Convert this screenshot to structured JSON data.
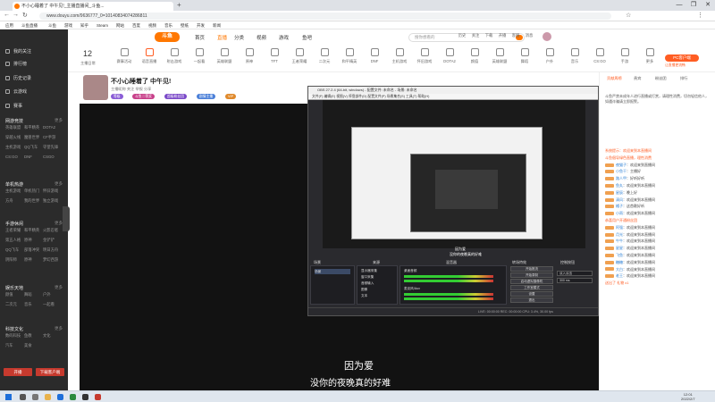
{
  "browser": {
    "tab_title": "不小心睡着了 中午见!_主播直播间_斗鱼...",
    "url": "www.douyu.com/9636777_0=10140834074286811",
    "bookmarks": [
      "应用",
      "斗鱼直播",
      "斗鱼",
      "游戏",
      "知乎",
      "Steam",
      "网站",
      "百度",
      "视频",
      "音乐",
      "壁纸",
      "开发",
      "新闻"
    ],
    "win_controls": [
      "—",
      "❐",
      "✕"
    ]
  },
  "sidebar": {
    "top_items": [
      "我的关注",
      "排行榜",
      "历史记录",
      "云游戏",
      "赛事"
    ],
    "sections": [
      {
        "title": "网游竞技",
        "more": "更多",
        "items": [
          "英雄联盟",
          "和平精英",
          "DOTA2",
          "穿越火线",
          "魔兽世界",
          "CF手游",
          "主机游戏",
          "QQ飞车",
          "守望先锋",
          "CS:GO",
          "DNF",
          "CSGO"
        ]
      },
      {
        "title": "单机热游",
        "more": "更多",
        "items": [
          "主机游戏",
          "单机热门",
          "怀旧游戏",
          "方舟",
          "我的世界",
          "独立游戏"
        ]
      },
      {
        "title": "手游休闲",
        "more": "更多",
        "items": [
          "王者荣耀",
          "和平精英",
          "火影忍者",
          "第五人格",
          "原神",
          "金铲铲",
          "QQ飞车",
          "部落冲突",
          "明日方舟",
          "阴阳师",
          "原神",
          "梦幻西游"
        ]
      },
      {
        "title": "娱乐天地",
        "more": "更多",
        "items": [
          "颜值",
          "舞蹈",
          "户外",
          "二次元",
          "音乐",
          "一起看"
        ]
      },
      {
        "title": "科技文化",
        "more": "更多",
        "items": [
          "数码科技",
          "鱼教",
          "文化",
          "汽车",
          "美食"
        ]
      }
    ],
    "btn_live": "开播",
    "btn_download": "下载客户端"
  },
  "topnav": {
    "items": [
      "首页",
      "直播",
      "分类",
      "视频",
      "游戏",
      "鱼吧"
    ],
    "logo": "斗鱼",
    "search_placeholder": "搜你想看的",
    "user_tools": [
      "历史",
      "关注",
      "下载",
      "开播",
      "客服",
      "消息"
    ]
  },
  "catbar": {
    "day": "12",
    "day_label": "主播日常",
    "cats": [
      "赛事活动",
      "语音直播",
      "射击游戏",
      "一起看",
      "英雄联盟",
      "原神",
      "TFT",
      "王者荣耀",
      "二次元",
      "和平精英",
      "DNF",
      "主机游戏",
      "怀旧游戏",
      "DOTA2",
      "颜值",
      "英雄联盟",
      "舞蹈",
      "户外",
      "音乐",
      "CS:GO",
      "手游",
      "更多"
    ],
    "pc_btn": "PC客户端",
    "pc_sub": "让直播更流畅"
  },
  "stream": {
    "title": "不小心睡着了 中午见!",
    "meta": "主播昵称   关注   举报   分享",
    "badges": [
      "等级",
      "斗鱼二等奖",
      "超级粉丝团",
      "剧情主播",
      "VIP"
    ]
  },
  "video": {
    "subtitle_1": "因为爱",
    "subtitle_2": "没你的夜晚真的好难"
  },
  "obs": {
    "title": "OBS 27.2.4 (64-bit, windows) - 配置文件: 未命名 - 场景: 未命名",
    "menu": "文件(F)  编辑(E)  视图(V)  停靠部件(D)  配置文件(P)  场景集合(S)  工具(T)  帮助(H)",
    "preview_sub_1": "因为爱",
    "preview_sub_2": "没你的夜晚真的好难",
    "dock_labels": [
      "场景",
      "来源",
      "混音器",
      "转场特效",
      "控制按钮"
    ],
    "scene": "场景",
    "sources": [
      "显示器采集",
      "窗口采集",
      "音频输入",
      "图像",
      "文本"
    ],
    "controls": [
      "开始推流",
      "开始录制",
      "启动虚拟摄像机",
      "工作室模式",
      "设置",
      "退出"
    ],
    "mixer_tracks": [
      "桌面音频",
      "麦克风/Aux"
    ],
    "transition": "淡入淡出",
    "duration": "300 ms",
    "status": "LIVE: 00:00:00   REC: 00:00:00   CPU: 3.4%, 30.00 fps"
  },
  "chat": {
    "tabs": [
      "贡献周榜",
      "贵宾",
      "粉丝团",
      "排行"
    ],
    "notice": "斗鱼严禁未成年人进行直播或打赏，请理性消费，切勿轻信他人，如遇诈骗请立即报警。",
    "messages": [
      {
        "type": "sys",
        "text": "系统提示：欢迎来到本直播间"
      },
      {
        "type": "sys",
        "text": "斗鱼倡导绿色直播，理性消费"
      },
      {
        "type": "msg",
        "user": "夜猫子",
        "text": "欢迎来到直播间"
      },
      {
        "type": "msg",
        "user": "小鱼干",
        "text": "主播好"
      },
      {
        "type": "msg",
        "user": "路人甲",
        "text": "好听好听"
      },
      {
        "type": "msg",
        "user": "鱼丸",
        "text": "欢迎来到本直播间"
      },
      {
        "type": "msg",
        "user": "星辰",
        "text": "晚上好"
      },
      {
        "type": "msg",
        "user": "清风",
        "text": "欢迎来到本直播间"
      },
      {
        "type": "msg",
        "user": "橘子",
        "text": "这首歌好听"
      },
      {
        "type": "msg",
        "user": "小雨",
        "text": "欢迎来到本直播间"
      },
      {
        "type": "sys",
        "text": "恭喜用户开通粉丝团"
      },
      {
        "type": "msg",
        "user": "阿强",
        "text": "欢迎来到本直播间"
      },
      {
        "type": "msg",
        "user": "月光",
        "text": "欢迎来到本直播间"
      },
      {
        "type": "msg",
        "user": "牛牛",
        "text": "欢迎来到本直播间"
      },
      {
        "type": "msg",
        "user": "星星",
        "text": "欢迎来到本直播间"
      },
      {
        "type": "msg",
        "user": "飞鱼",
        "text": "欢迎来到本直播间"
      },
      {
        "type": "msg",
        "user": "糖糖",
        "text": "欢迎来到本直播间"
      },
      {
        "type": "msg",
        "user": "大白",
        "text": "欢迎来到本直播间"
      },
      {
        "type": "msg",
        "user": "老王",
        "text": "欢迎来到本直播间"
      },
      {
        "type": "sys",
        "text": "送出了 礼物 x1"
      }
    ]
  },
  "taskbar": {
    "time": "12:01",
    "date": "2022/2/7"
  }
}
